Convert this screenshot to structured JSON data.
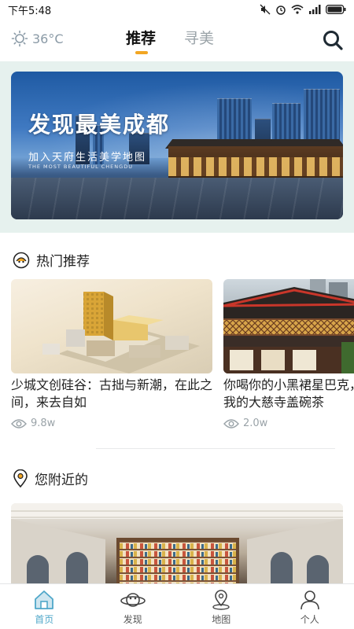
{
  "status_bar": {
    "time": "下午5:48"
  },
  "header": {
    "temperature": "36°C",
    "tabs": [
      {
        "label": "推荐",
        "active": true
      },
      {
        "label": "寻美",
        "active": false
      }
    ]
  },
  "banner": {
    "title": "发现最美成都",
    "subtitle": "加入天府生活美学地图",
    "subtitle_en": "THE MOST BEAUTIFUL CHENGDU"
  },
  "hot": {
    "title": "热门推荐",
    "cards": [
      {
        "title": "少城文创硅谷：古拙与新潮，在此之间，来去自如",
        "views": "9.8w"
      },
      {
        "title": "你喝你的小黑裙星巴克，我的大慈寺盖碗茶",
        "views": "2.0w"
      }
    ]
  },
  "nearby": {
    "title": "您附近的"
  },
  "bottom_nav": [
    {
      "label": "首页",
      "icon": "home-icon",
      "active": true
    },
    {
      "label": "发现",
      "icon": "planet-icon",
      "active": false
    },
    {
      "label": "地图",
      "icon": "map-pin-icon",
      "active": false
    },
    {
      "label": "个人",
      "icon": "user-icon",
      "active": false
    }
  ],
  "colors": {
    "accent": "#4fa7c9",
    "tab_indicator": "#f2a623",
    "banner_bg": "#e6f1ee"
  }
}
